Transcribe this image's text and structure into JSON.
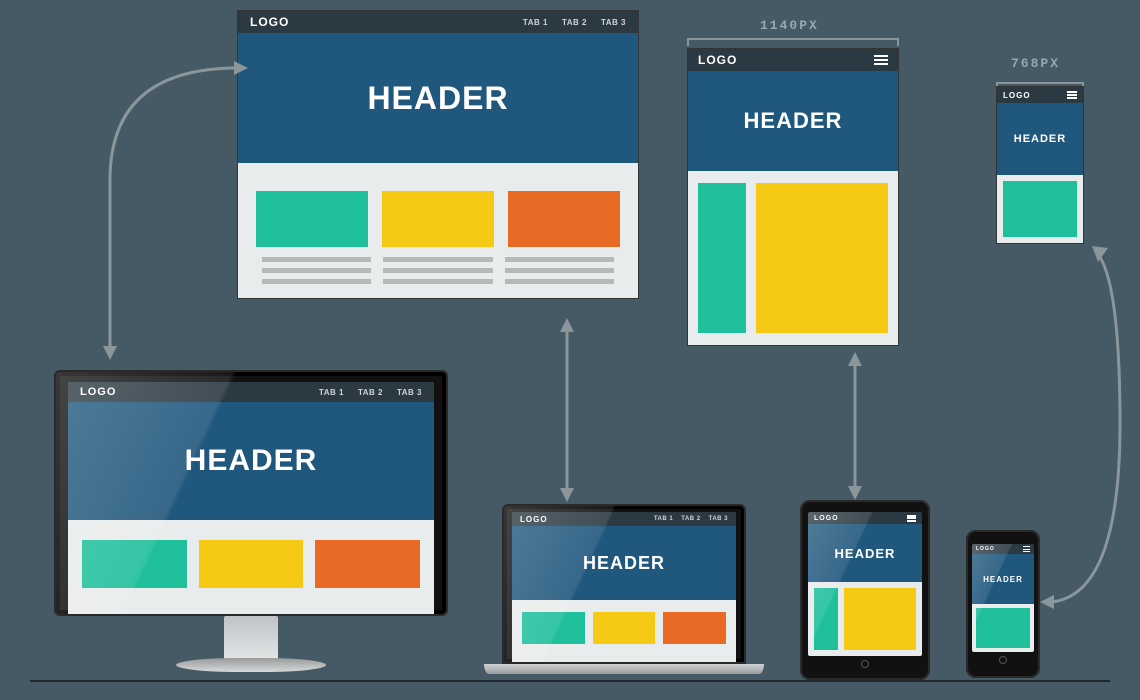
{
  "common": {
    "logo": "LOGO",
    "header": "HEADER",
    "tabs": [
      "TAB 1",
      "TAB 2",
      "TAB 3"
    ]
  },
  "breakpoints": {
    "tablet": "1140PX",
    "phone": "768PX"
  },
  "colors": {
    "topbar": "#2b3a42",
    "header": "#20577d",
    "body": "#e9ecec",
    "teal": "#1fbf9c",
    "yellow": "#f6c915",
    "orange": "#e86a25",
    "arrow": "#8a969a"
  }
}
